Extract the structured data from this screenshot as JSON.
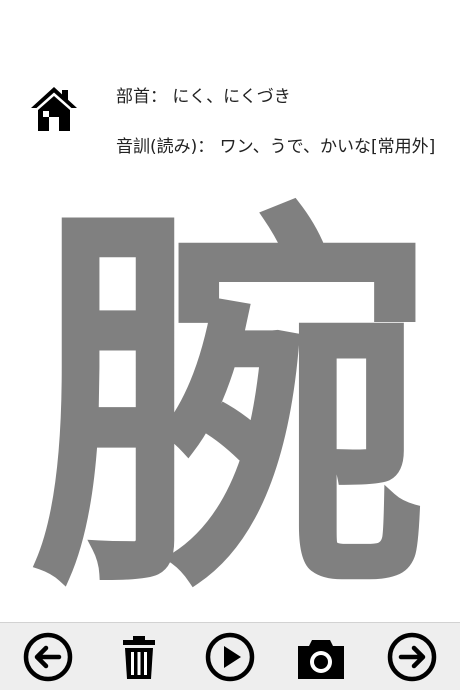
{
  "header": {
    "home_icon": "home-icon",
    "radical_label": "部首：",
    "radical_value": "にく、にくづき",
    "reading_label": "音訓(読み)：",
    "reading_value": "ワン、うで、かいな[常用外]"
  },
  "kanji": {
    "character": "腕",
    "color": "#808080"
  },
  "toolbar": {
    "background": "#eeeeee",
    "icons": [
      "arrow-left-circle-icon",
      "trash-icon",
      "play-circle-icon",
      "camera-icon",
      "arrow-right-circle-icon"
    ]
  }
}
